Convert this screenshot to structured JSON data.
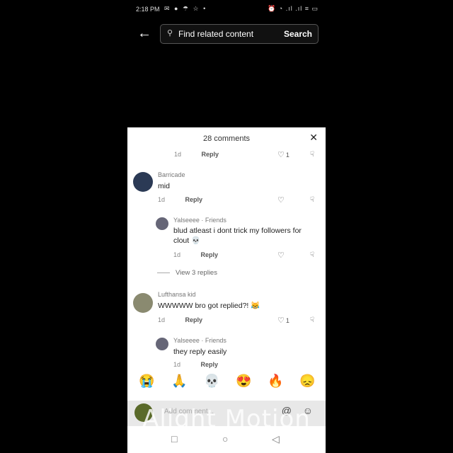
{
  "status_bar": {
    "time": "2:18 PM",
    "indicators": "✉ ● ☂ ☆ •",
    "right": "⏰ ◔ .ıl .ıl ≡ ▭"
  },
  "search": {
    "back_icon": "arrow-left-icon",
    "placeholder": "Find related content",
    "button": "Search"
  },
  "sheet": {
    "title": "28 comments",
    "comments": [
      {
        "time": "1d",
        "reply": "Reply",
        "likes": "1"
      },
      {
        "name": "Barricade",
        "text": "mid",
        "time": "1d",
        "reply": "Reply"
      },
      {
        "name": "Yalseeee · Friends",
        "text": "blud atleast i dont trick my followers for clout 💀",
        "time": "1d",
        "reply": "Reply"
      },
      {
        "view_more": "View 3 replies"
      },
      {
        "name": "Lufthansa kid",
        "text": "WWWWW bro got replied?! 😹",
        "time": "1d",
        "reply": "Reply",
        "likes": "1"
      },
      {
        "name": "Yalseeee · Friends",
        "text": "they reply easily",
        "time": "1d",
        "reply": "Reply"
      }
    ],
    "emojis": [
      "😭",
      "🙏",
      "💀",
      "😍",
      "🔥",
      "😞"
    ],
    "input_placeholder": "Add comment...",
    "at_symbol": "@",
    "smile_symbol": "☺"
  },
  "watermark": "Alight Motion",
  "nav": {
    "square": "□",
    "circle": "○",
    "back": "◁"
  }
}
